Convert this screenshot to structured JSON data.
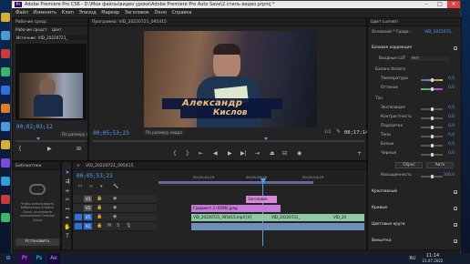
{
  "window": {
    "app_icon": "Pr",
    "title": "Adobe Premiere Pro CS6 - D:\\Мои файлы\\видео уроки\\Adobe Premiere Pro Auto Save\\2 стиль видео.prproj *"
  },
  "menu": [
    "Файл",
    "Изменить",
    "Клип",
    "Эпизод",
    "Маркер",
    "Заголовок",
    "Окно",
    "Справка"
  ],
  "source_panel": {
    "tabs": [
      "Рабочие средс",
      "Источник: VID_20220721_"
    ],
    "subtabs": [
      "Рабочие средст",
      "Цвет"
    ],
    "label": "Источник: VID_20220721_",
    "timecode": "00;02;03;12",
    "zoom": "По размеру кад"
  },
  "program_monitor": {
    "tab": "Программа: VID_20220721_095415",
    "timecode_left": "00;05;53;23",
    "zoom": "По размеру кадра",
    "fraction": "1/2",
    "timecode_right": "00;17;14;05",
    "lower_third": {
      "line1": "Александр",
      "line2": "Кислов"
    }
  },
  "effect_controls": {
    "tab": "Цвет Lumetri",
    "master": "Основной * Гради...",
    "clip": "VID_2022072...",
    "sections": {
      "basic": "Базовая коррекция",
      "lut": "Входные LUT",
      "lut_value": "Нет",
      "white_balance": "Баланс белого",
      "tone": "Тон",
      "creative": "Креативный",
      "curves": "Кривые",
      "wheels": "Цветовые круги",
      "vignette": "Виньетка"
    },
    "rows": [
      {
        "label": "Температура",
        "value": "0,0"
      },
      {
        "label": "Оттенок",
        "value": "0,0"
      },
      {
        "label": "Экспозиция",
        "value": "0,0"
      },
      {
        "label": "Контрастность",
        "value": "0,0"
      },
      {
        "label": "Подсветка",
        "value": "0,0"
      },
      {
        "label": "Тени",
        "value": "0,0"
      },
      {
        "label": "Белые",
        "value": "0,0"
      },
      {
        "label": "Черные",
        "value": "0,0"
      }
    ],
    "reset_button": "Сброс",
    "auto_button": "Авто",
    "saturation_label": "Насыщенность",
    "saturation_value": "100,0"
  },
  "libraries": {
    "tab": "Библиотеки",
    "message": "Чтобы использовать библиотеки Creative Cloud, установите приложение Creative Cloud",
    "install_button": "Установить"
  },
  "timeline": {
    "tab": "VID_20220721_095415",
    "timecode": "00;05;53;23",
    "ruler": [
      "00;05;44;29",
      "00;05;49;29",
      "00;05;54;29"
    ],
    "tracks": [
      "V3",
      "V2",
      "V1",
      "A1"
    ],
    "clips": {
      "title": "Заголовок",
      "gradient": "Градиент 2 (0596).jpeg",
      "v1_a": "VID_20220721_095415.mp4 [V]",
      "v1_b": "VID_20220721_",
      "v1_c": "VID_20"
    }
  },
  "taskbar": {
    "start_icon": "windows-icon",
    "apps": [
      "Pr",
      "Ps",
      "Ae"
    ],
    "language": "RU",
    "clock_time": "11:14",
    "clock_date": "21.07.2022"
  }
}
